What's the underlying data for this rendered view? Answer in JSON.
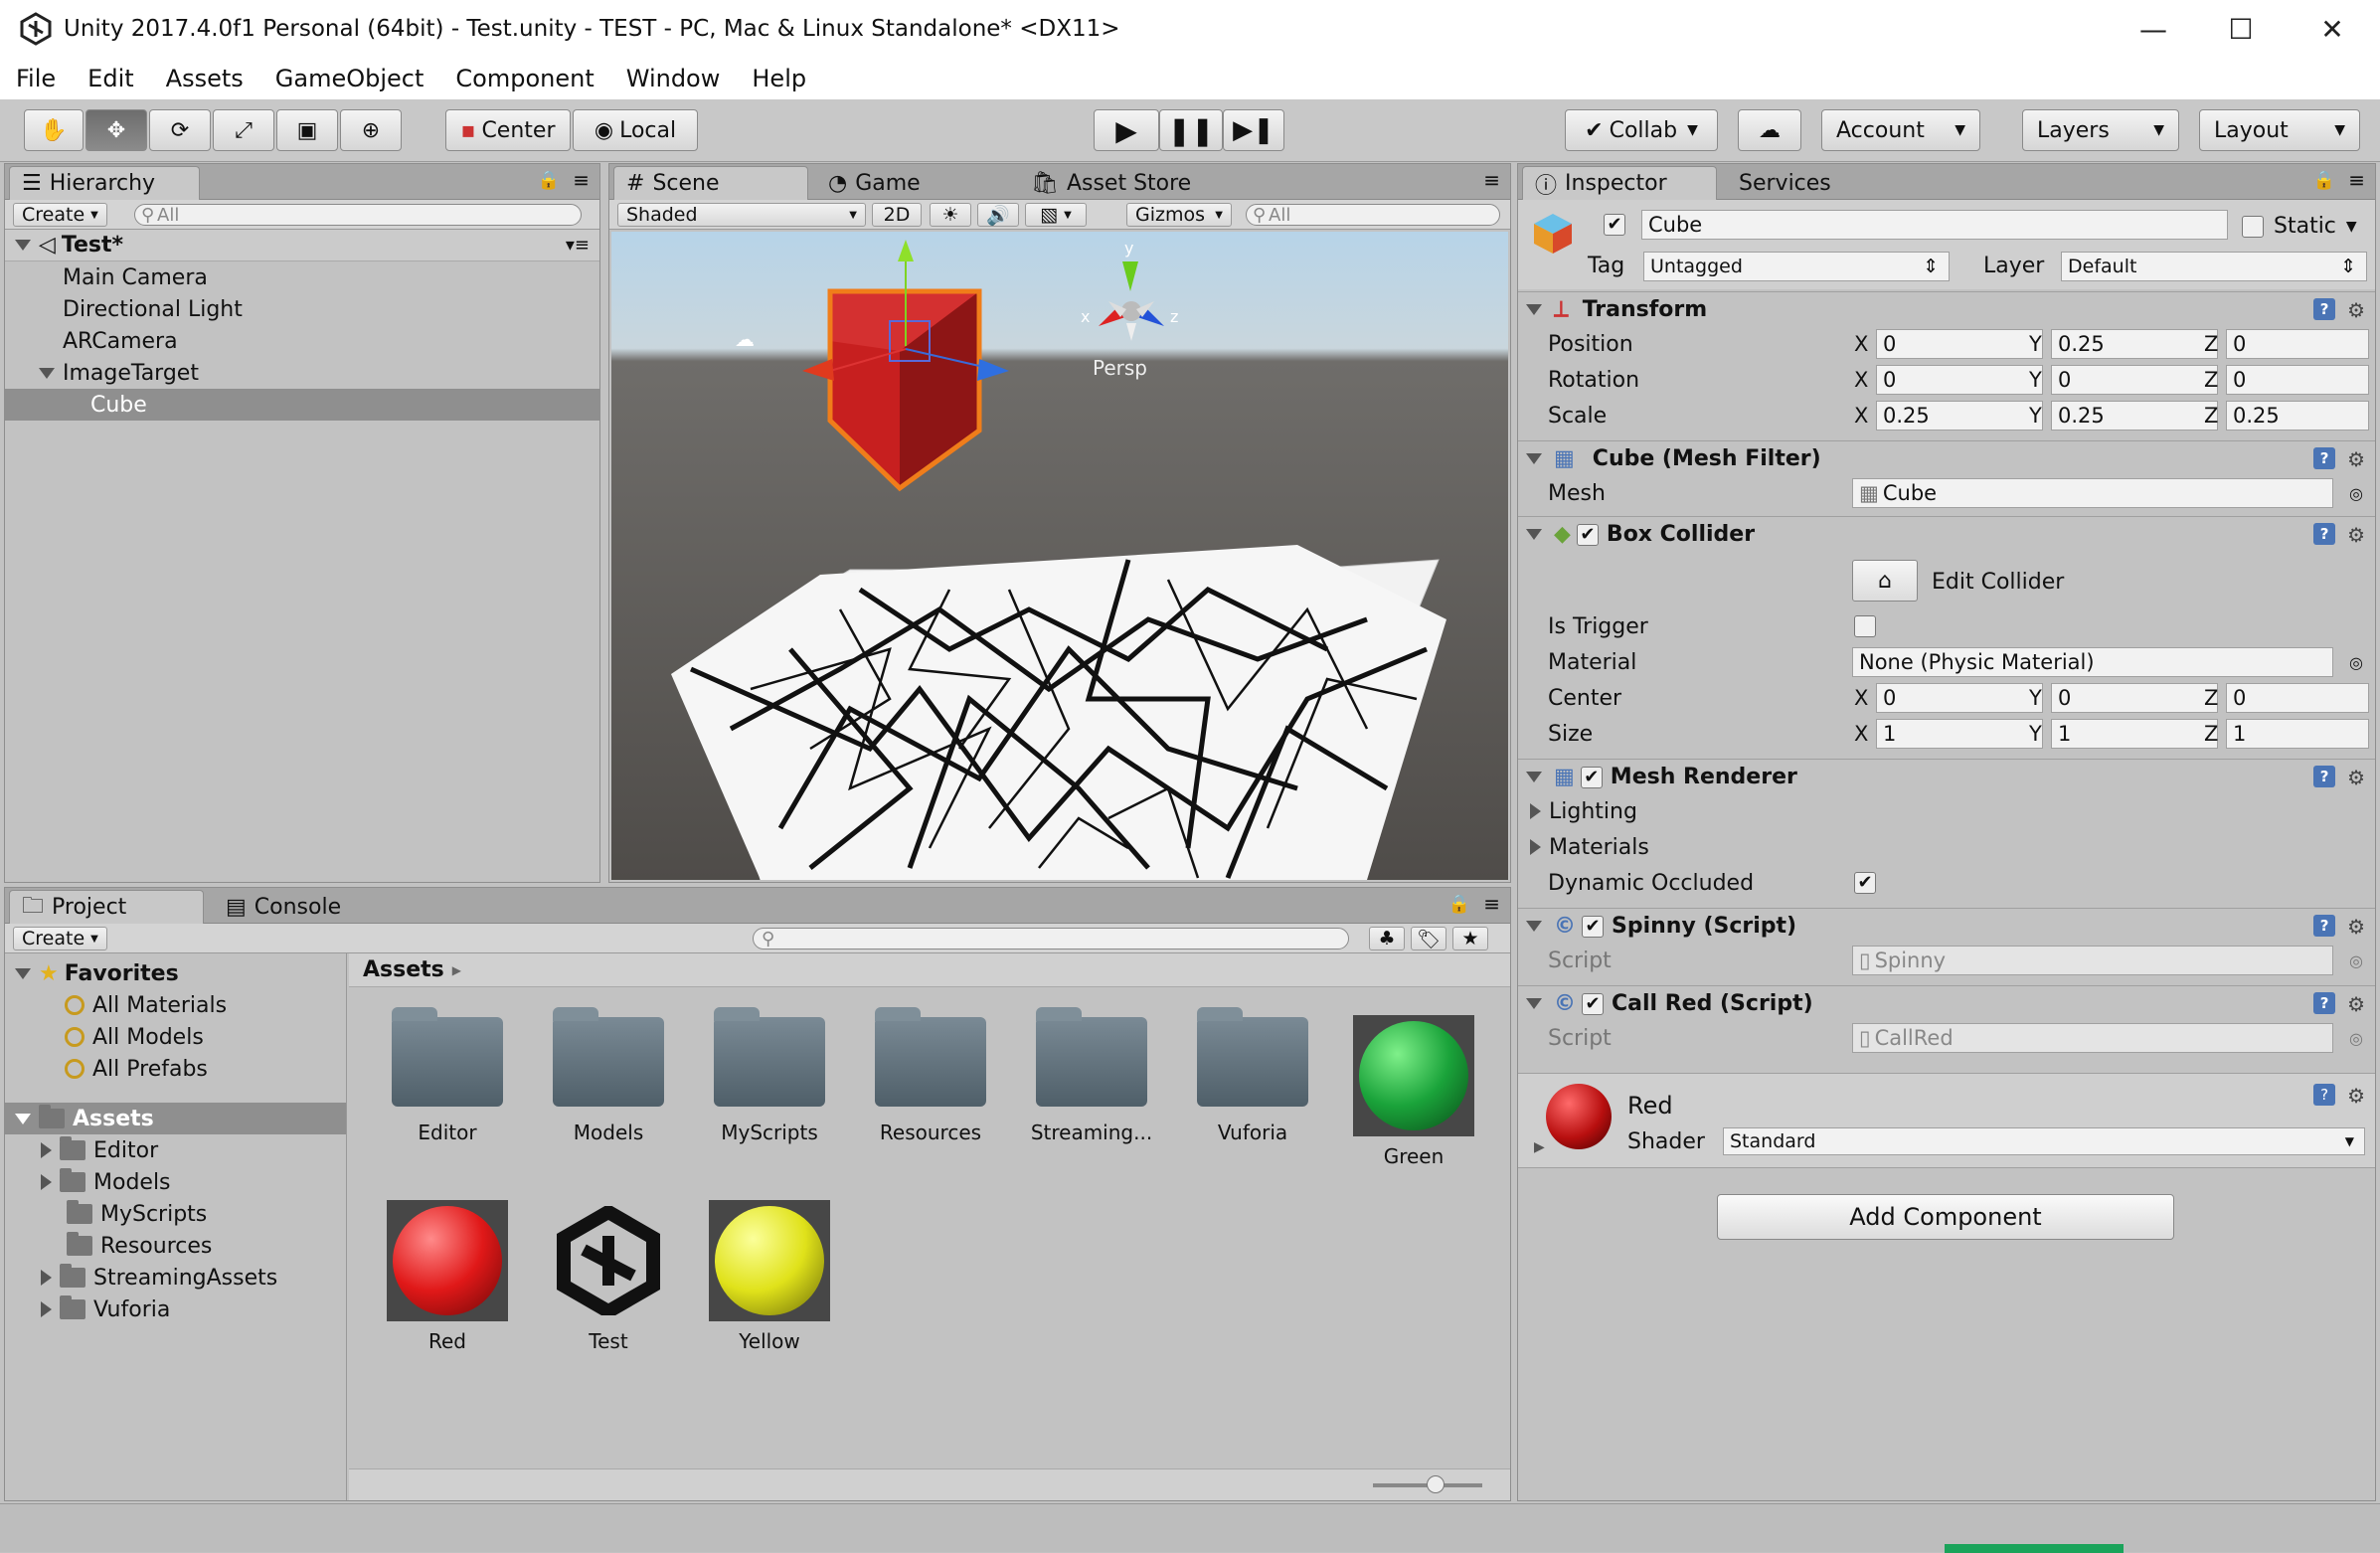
{
  "window": {
    "title": "Unity 2017.4.0f1 Personal (64bit) - Test.unity - TEST - PC, Mac & Linux Standalone* <DX11>",
    "minimize": "—",
    "maximize": "☐",
    "close": "✕"
  },
  "menu": [
    "File",
    "Edit",
    "Assets",
    "GameObject",
    "Component",
    "Window",
    "Help"
  ],
  "toolbar": {
    "center": "Center",
    "local": "Local",
    "collab": "Collab",
    "account": "Account",
    "layers": "Layers",
    "layout": "Layout"
  },
  "hierarchy": {
    "tab": "Hierarchy",
    "create": "Create",
    "search_placeholder": "All",
    "scene": "Test*",
    "items": [
      {
        "label": "Main Camera"
      },
      {
        "label": "Directional Light"
      },
      {
        "label": "ARCamera"
      },
      {
        "label": "ImageTarget"
      },
      {
        "label": "Cube"
      }
    ]
  },
  "scene": {
    "tabs": [
      "Scene",
      "Game",
      "Asset Store"
    ],
    "shading": "Shaded",
    "mode2d": "2D",
    "gizmos": "Gizmos",
    "search_placeholder": "All",
    "persp": "Persp",
    "axis_y": "y",
    "axis_x": "x",
    "axis_z": "z"
  },
  "project": {
    "tabs": [
      "Project",
      "Console"
    ],
    "create": "Create",
    "favorites": "Favorites",
    "fav_items": [
      "All Materials",
      "All Models",
      "All Prefabs"
    ],
    "assets_root": "Assets",
    "tree": [
      "Editor",
      "Models",
      "MyScripts",
      "Resources",
      "StreamingAssets",
      "Vuforia"
    ],
    "breadcrumb": "Assets",
    "grid": [
      {
        "label": "Editor",
        "kind": "folder"
      },
      {
        "label": "Models",
        "kind": "folder"
      },
      {
        "label": "MyScripts",
        "kind": "folder"
      },
      {
        "label": "Resources",
        "kind": "folder"
      },
      {
        "label": "Streaming...",
        "kind": "folder"
      },
      {
        "label": "Vuforia",
        "kind": "folder"
      },
      {
        "label": "Green",
        "kind": "material",
        "color": "#1aa33a"
      },
      {
        "label": "Red",
        "kind": "material",
        "color": "#e01818"
      },
      {
        "label": "Test",
        "kind": "scene"
      },
      {
        "label": "Yellow",
        "kind": "material",
        "color": "#e8ea1a"
      }
    ]
  },
  "inspector": {
    "tabs": [
      "Inspector",
      "Services"
    ],
    "name": "Cube",
    "static": "Static",
    "tag_label": "Tag",
    "tag": "Untagged",
    "layer_label": "Layer",
    "layer": "Default",
    "transform": {
      "title": "Transform",
      "position": {
        "label": "Position",
        "x": "0",
        "y": "0.25",
        "z": "0"
      },
      "rotation": {
        "label": "Rotation",
        "x": "0",
        "y": "0",
        "z": "0"
      },
      "scale": {
        "label": "Scale",
        "x": "0.25",
        "y": "0.25",
        "z": "0.25"
      }
    },
    "mesh_filter": {
      "title": "Cube (Mesh Filter)",
      "mesh_label": "Mesh",
      "mesh": "Cube"
    },
    "box_collider": {
      "title": "Box Collider",
      "edit": "Edit Collider",
      "is_trigger": "Is Trigger",
      "material_label": "Material",
      "material": "None (Physic Material)",
      "center_label": "Center",
      "cx": "0",
      "cy": "0",
      "cz": "0",
      "size_label": "Size",
      "sx": "1",
      "sy": "1",
      "sz": "1"
    },
    "mesh_renderer": {
      "title": "Mesh Renderer",
      "lighting": "Lighting",
      "materials": "Materials",
      "dyn": "Dynamic Occluded"
    },
    "spinny": {
      "title": "Spinny (Script)",
      "script_label": "Script",
      "script": "Spinny"
    },
    "callred": {
      "title": "Call Red (Script)",
      "script_label": "Script",
      "script": "CallRed"
    },
    "material": {
      "name": "Red",
      "shader_label": "Shader",
      "shader": "Standard"
    },
    "add_component": "Add Component"
  },
  "axes": {
    "x": "X",
    "y": "Y",
    "z": "Z"
  }
}
